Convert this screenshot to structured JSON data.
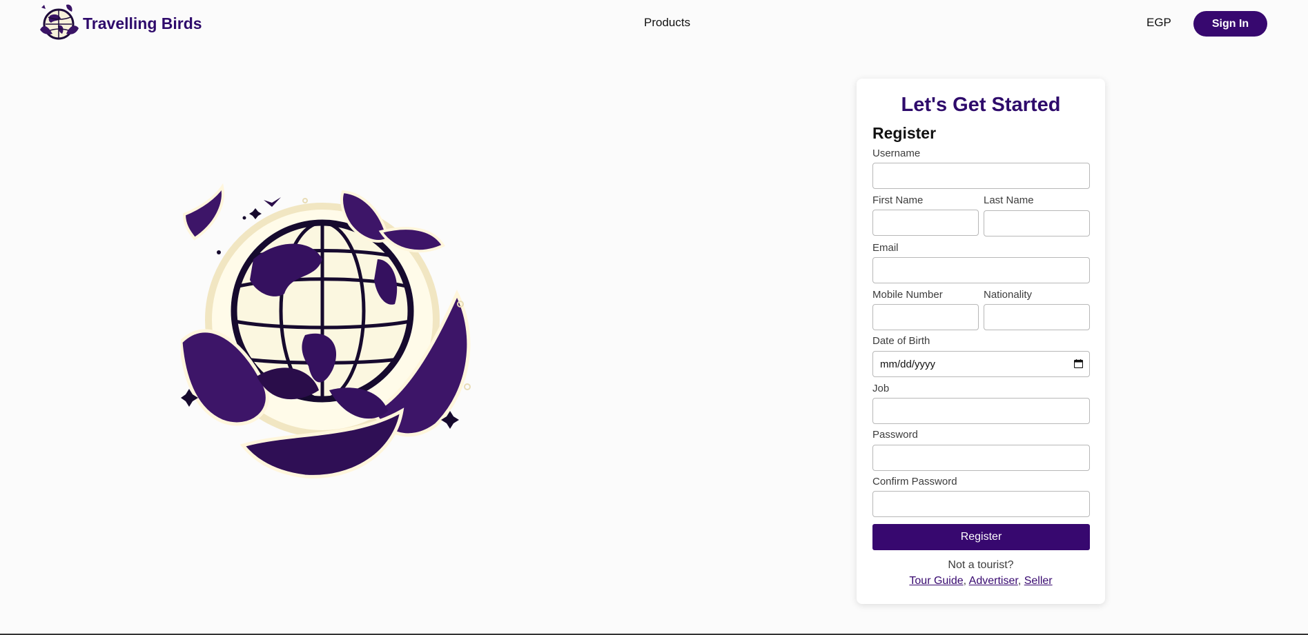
{
  "nav": {
    "brand_name": "Travelling Birds",
    "products_label": "Products",
    "currency_label": "EGP",
    "signin_label": "Sign In"
  },
  "form": {
    "title": "Let's Get Started",
    "subtitle": "Register",
    "username_label": "Username",
    "username_value": "",
    "first_name_label": "First Name",
    "first_name_value": "",
    "last_name_label": "Last Name",
    "last_name_value": "",
    "email_label": "Email",
    "email_value": "",
    "mobile_label": "Mobile Number",
    "mobile_value": "",
    "nationality_label": "Nationality",
    "nationality_value": "",
    "dob_label": "Date of Birth",
    "dob_placeholder": "mm/dd/yyyy",
    "job_label": "Job",
    "job_value": "",
    "password_label": "Password",
    "password_value": "",
    "confirm_password_label": "Confirm Password",
    "confirm_password_value": "",
    "register_label": "Register",
    "not_tourist_text": "Not a tourist?",
    "links": {
      "tour_guide": "Tour Guide",
      "advertiser": "Advertiser",
      "seller": "Seller",
      "separator": ", "
    }
  },
  "colors": {
    "brand": "#2e0a6b",
    "button": "#37086f",
    "globe": "#fbf7e0"
  }
}
